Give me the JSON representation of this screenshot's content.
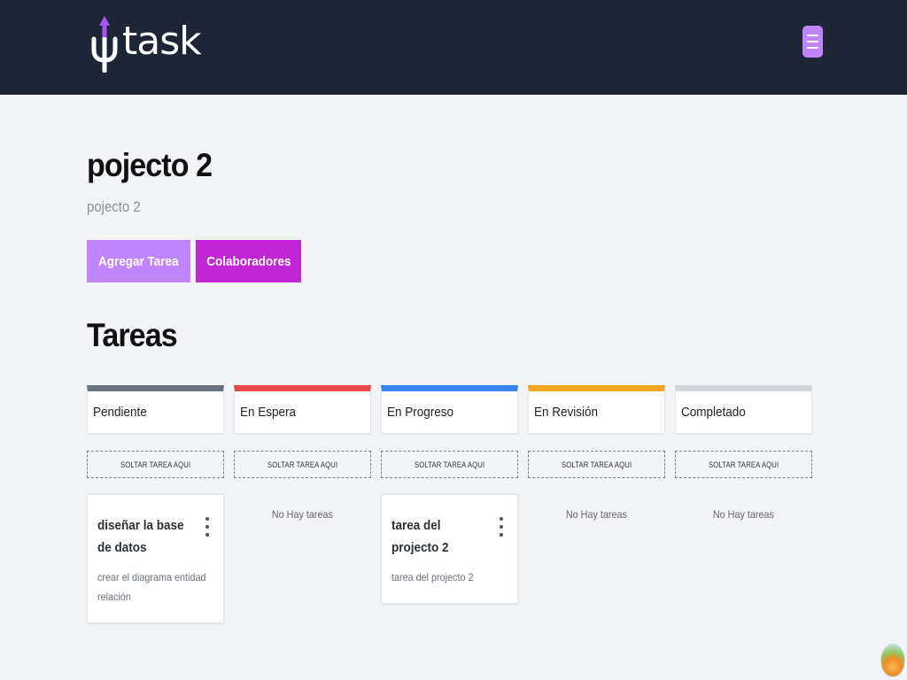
{
  "header": {
    "logo_text": "task",
    "brand_colors": {
      "bar": "#1e2534",
      "accent": "#c084fc"
    },
    "menu_icon": "hamburger-icon"
  },
  "project": {
    "title": "pojecto 2",
    "description": "pojecto 2",
    "add_task_label": "Agregar Tarea",
    "collaborators_label": "Colaboradores"
  },
  "tasks_section_title": "Tareas",
  "columns": [
    {
      "label": "Pendiente",
      "color": "#6b7280",
      "drop_label": "SOLTAR TAREA AQUI",
      "cards": [
        {
          "title": "diseñar la base de datos",
          "description": "crear el diagrama entidad relación"
        }
      ]
    },
    {
      "label": "En Espera",
      "color": "#e5484d",
      "drop_label": "SOLTAR TAREA AQUI",
      "empty_label": "No Hay tareas"
    },
    {
      "label": "En Progreso",
      "color": "#3b82f6",
      "drop_label": "SOLTAR TAREA AQUI",
      "cards": [
        {
          "title": "tarea del projecto 2",
          "description": "tarea del projecto 2"
        }
      ]
    },
    {
      "label": "En Revisión",
      "color": "#f5a524",
      "drop_label": "SOLTAR TAREA AQUI",
      "empty_label": "No Hay tareas"
    },
    {
      "label": "Completado",
      "color": "#d1d5db",
      "drop_label": "SOLTAR TAREA AQUI",
      "empty_label": "No Hay tareas"
    }
  ]
}
